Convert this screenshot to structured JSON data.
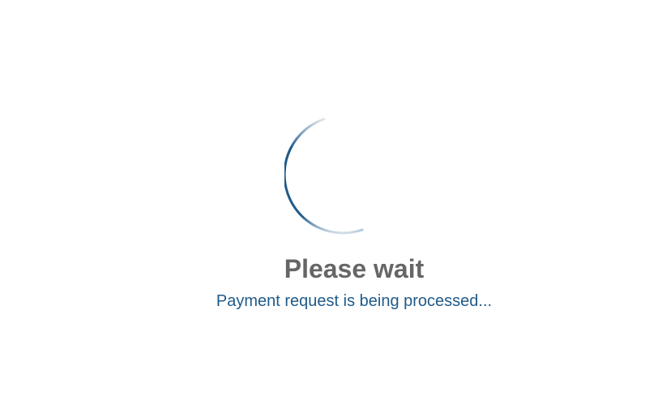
{
  "loader": {
    "title": "Please wait",
    "message": "Payment request is being processed...",
    "spinner_icon": "loading-spinner-icon",
    "accent_color": "#1f5a8a",
    "title_color": "#666666"
  }
}
